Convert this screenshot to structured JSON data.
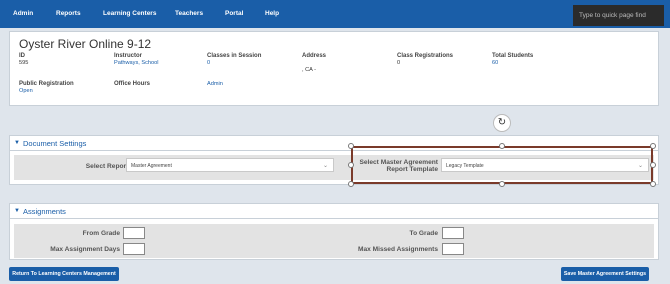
{
  "nav": {
    "items": [
      "Admin",
      "Reports",
      "Learning Centers",
      "Teachers",
      "Portal",
      "Help"
    ],
    "quickfind_placeholder": "Type to quick page find"
  },
  "school": {
    "title": "Oyster River Online 9-12",
    "id_label": "ID",
    "id_value": "595",
    "instructor_label": "Instructor",
    "instructor_value": "Pathways, School",
    "classes_label": "Classes in Session",
    "classes_value": "0",
    "address_label": "Address",
    "address_value": ", CA -",
    "registrations_label": "Class Registrations",
    "registrations_value": "0",
    "total_label": "Total Students",
    "total_value": "60",
    "public_label": "Public Registration",
    "public_value": "Open",
    "office_label": "Office Hours",
    "admin_link": "Admin"
  },
  "document_settings": {
    "title": "Document Settings",
    "report_type_label": "Select Report Type",
    "report_type_value": "Master Agreement",
    "template_label_line1": "Select Master Agreement",
    "template_label_line2": "Report Template",
    "template_value": "Legacy Template"
  },
  "assignments": {
    "title": "Assignments",
    "from_grade": "From Grade",
    "to_grade": "To Grade",
    "max_days": "Max Assignment Days",
    "max_missed": "Max Missed Assignments"
  },
  "buttons": {
    "return": "Return To Learning Centers Management",
    "save": "Save Master Agreement Settings"
  }
}
